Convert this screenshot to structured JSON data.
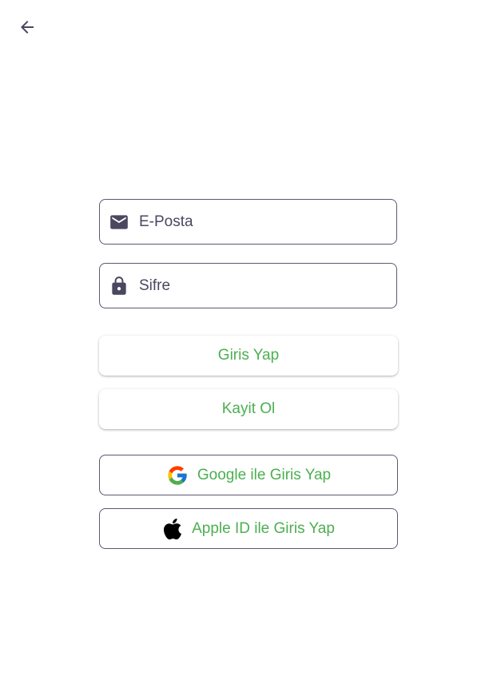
{
  "header": {
    "back_icon": "arrow-left-icon"
  },
  "form": {
    "email": {
      "placeholder": "E-Posta",
      "value": "",
      "icon": "mail-icon"
    },
    "password": {
      "placeholder": "Sifre",
      "value": "",
      "icon": "lock-icon"
    }
  },
  "actions": {
    "login_label": "Giris Yap",
    "signup_label": "Kayit Ol",
    "google_label": "Google ile Giris Yap",
    "google_icon": "google-icon",
    "apple_label": "Apple ID ile Giris Yap",
    "apple_icon": "apple-icon"
  },
  "colors": {
    "accent": "#4caf50",
    "border": "#5b5870",
    "icon": "#4a4760"
  }
}
